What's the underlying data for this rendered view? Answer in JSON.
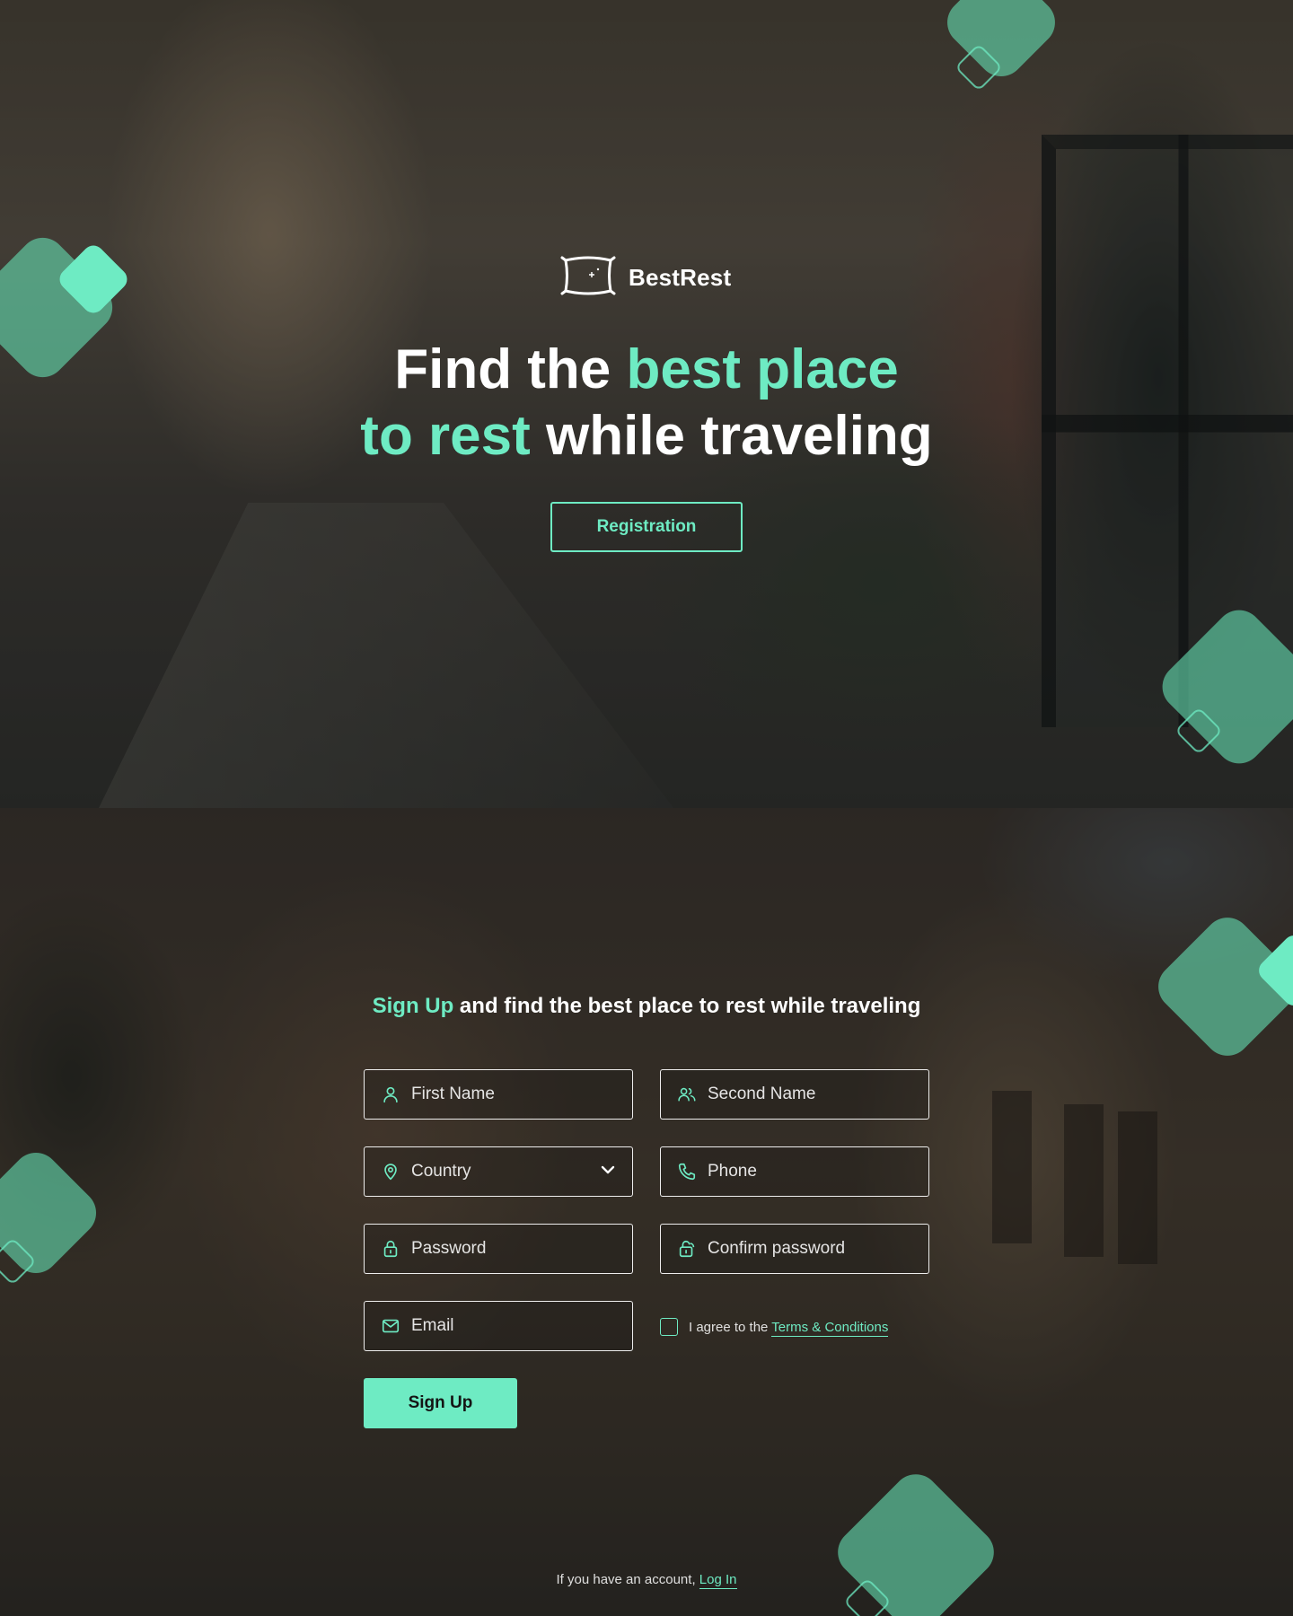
{
  "brand": {
    "name": "BestRest"
  },
  "hero": {
    "title_line1_plain": "Find the ",
    "title_line1_accent": "best place",
    "title_line2_accent": "to rest",
    "title_line2_plain": " while traveling",
    "registration_label": "Registration"
  },
  "signup": {
    "heading_accent": "Sign Up",
    "heading_rest": " and find the best place to rest while traveling",
    "fields": {
      "first_name": {
        "placeholder": "First Name",
        "icon": "user-icon"
      },
      "second_name": {
        "placeholder": "Second Name",
        "icon": "users-icon"
      },
      "country": {
        "placeholder": "Country",
        "icon": "location-pin-icon"
      },
      "phone": {
        "placeholder": "Phone",
        "icon": "phone-icon"
      },
      "password": {
        "placeholder": "Password",
        "icon": "lock-icon"
      },
      "confirm_password": {
        "placeholder": "Confirm password",
        "icon": "lock-open-icon"
      },
      "email": {
        "placeholder": "Email",
        "icon": "mail-icon"
      }
    },
    "agree_text": "I agree to the ",
    "terms_link": "Terms & Conditions",
    "submit_label": "Sign Up",
    "login_prompt": "If you have an account, ",
    "login_link": "Log In"
  },
  "colors": {
    "accent": "#6eebc3",
    "text": "#ffffff",
    "button_text": "#141414"
  }
}
